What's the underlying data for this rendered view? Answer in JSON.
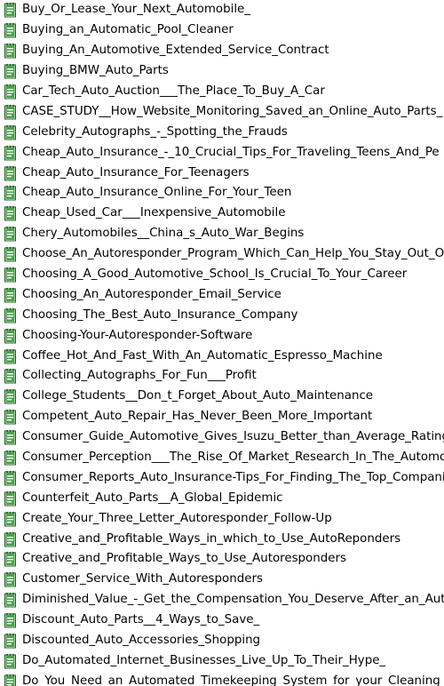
{
  "files": [
    {
      "name": "Buy_Or_Lease_Your_Next_Automobile_",
      "icon": "notepad-document-icon"
    },
    {
      "name": "Buying_an_Automatic_Pool_Cleaner",
      "icon": "notepad-document-icon"
    },
    {
      "name": "Buying_An_Automotive_Extended_Service_Contract",
      "icon": "notepad-document-icon"
    },
    {
      "name": "Buying_BMW_Auto_Parts",
      "icon": "notepad-document-icon"
    },
    {
      "name": "Car_Tech_Auto_Auction___The_Place_To_Buy_A_Car",
      "icon": "notepad-document-icon"
    },
    {
      "name": "CASE_STUDY__How_Website_Monitoring_Saved_an_Online_Auto_Parts_",
      "icon": "notepad-document-icon"
    },
    {
      "name": "Celebrity_Autographs_-_Spotting_the_Frauds",
      "icon": "notepad-document-icon"
    },
    {
      "name": "Cheap_Auto_Insurance_-_10_Crucial_Tips_For_Traveling_Teens_And_Pe",
      "icon": "notepad-document-icon"
    },
    {
      "name": "Cheap_Auto_Insurance_For_Teenagers",
      "icon": "notepad-document-icon"
    },
    {
      "name": "Cheap_Auto_Insurance_Online_For_Your_Teen",
      "icon": "notepad-document-icon"
    },
    {
      "name": "Cheap_Used_Car___Inexpensive_Automobile",
      "icon": "notepad-document-icon"
    },
    {
      "name": "Chery_Automobiles__China_s_Auto_War_Begins",
      "icon": "notepad-document-icon"
    },
    {
      "name": "Choose_An_Autoresponder_Program_Which_Can_Help_You_Stay_Out_O",
      "icon": "notepad-document-icon"
    },
    {
      "name": "Choosing_A_Good_Automotive_School_Is_Crucial_To_Your_Career",
      "icon": "notepad-document-icon"
    },
    {
      "name": "Choosing_An_Autoresponder_Email_Service",
      "icon": "notepad-document-icon"
    },
    {
      "name": "Choosing_The_Best_Auto_Insurance_Company",
      "icon": "notepad-document-icon"
    },
    {
      "name": "Choosing-Your-Autoresponder-Software",
      "icon": "notepad-document-icon"
    },
    {
      "name": "Coffee_Hot_And_Fast_With_An_Automatic_Espresso_Machine",
      "icon": "notepad-document-icon"
    },
    {
      "name": "Collecting_Autographs_For_Fun___Profit",
      "icon": "notepad-document-icon"
    },
    {
      "name": "College_Students__Don_t_Forget_About_Auto_Maintenance",
      "icon": "notepad-document-icon"
    },
    {
      "name": "Competent_Auto_Repair_Has_Never_Been_More_Important",
      "icon": "notepad-document-icon"
    },
    {
      "name": "Consumer_Guide_Automotive_Gives_Isuzu_Better_than_Average_Rating",
      "icon": "notepad-document-icon"
    },
    {
      "name": "Consumer_Perception___The_Rise_Of_Market_Research_In_The_Automo",
      "icon": "notepad-document-icon"
    },
    {
      "name": "Consumer_Reports_Auto_Insurance-Tips_For_Finding_The_Top_Compani",
      "icon": "notepad-document-icon"
    },
    {
      "name": "Counterfeit_Auto_Parts__A_Global_Epidemic",
      "icon": "notepad-document-icon"
    },
    {
      "name": "Create_Your_Three_Letter_Autoresponder_Follow-Up",
      "icon": "notepad-document-icon"
    },
    {
      "name": "Creative_and_Profitable_Ways_in_which_to_Use_AutoReponders",
      "icon": "notepad-document-icon"
    },
    {
      "name": "Creative_and_Profitable_Ways_to_Use_Autoresponders",
      "icon": "notepad-document-icon"
    },
    {
      "name": "Customer_Service_With_Autoresponders",
      "icon": "notepad-document-icon"
    },
    {
      "name": "Diminished_Value_-_Get_the_Compensation_You_Deserve_After_an_Auto",
      "icon": "notepad-document-icon"
    },
    {
      "name": "Discount_Auto_Parts__4_Ways_to_Save_",
      "icon": "notepad-document-icon"
    },
    {
      "name": "Discounted_Auto_Accessories_Shopping",
      "icon": "notepad-document-icon"
    },
    {
      "name": "Do_Automated_Internet_Businesses_Live_Up_To_Their_Hype_",
      "icon": "notepad-document-icon"
    },
    {
      "name": "Do_You_Need_an_Automated_Timekeeping_System_for_your_Cleaning_B",
      "icon": "notepad-document-icon"
    }
  ],
  "colors": {
    "icon_green": "#2f8f2f",
    "icon_dark_green": "#1d5e1d",
    "icon_paper": "#ffffff",
    "text": "#000000",
    "background": "#ffffff"
  }
}
